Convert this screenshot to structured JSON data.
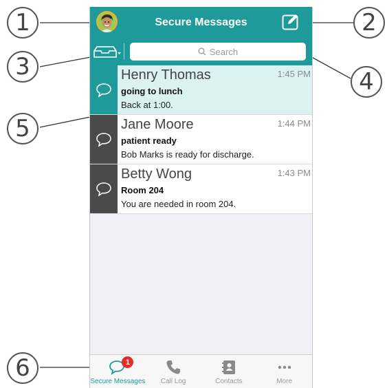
{
  "header": {
    "title": "Secure Messages"
  },
  "search": {
    "placeholder": "Search"
  },
  "messages": [
    {
      "name": "Henry Thomas",
      "time": "1:45 PM",
      "subject": "going to lunch",
      "preview": "Back at 1:00."
    },
    {
      "name": "Jane Moore",
      "time": "1:44 PM",
      "subject": "patient ready",
      "preview": "Bob Marks is ready for discharge."
    },
    {
      "name": "Betty Wong",
      "time": "1:43 PM",
      "subject": "Room 204",
      "preview": "You are needed in room 204."
    }
  ],
  "tabs": [
    {
      "label": "Secure Messages",
      "icon": "chat-bubble-icon",
      "badge": "1",
      "active": true
    },
    {
      "label": "Call Log",
      "icon": "phone-icon"
    },
    {
      "label": "Contacts",
      "icon": "contacts-book-icon"
    },
    {
      "label": "More",
      "icon": "more-dots-icon"
    }
  ],
  "callouts": [
    "1",
    "2",
    "3",
    "4",
    "5",
    "6"
  ],
  "colors": {
    "accent": "#1e9a9a",
    "badge": "#e62b2b",
    "dark_side": "#4a4a4a",
    "selected_row": "#dcf1f2"
  }
}
